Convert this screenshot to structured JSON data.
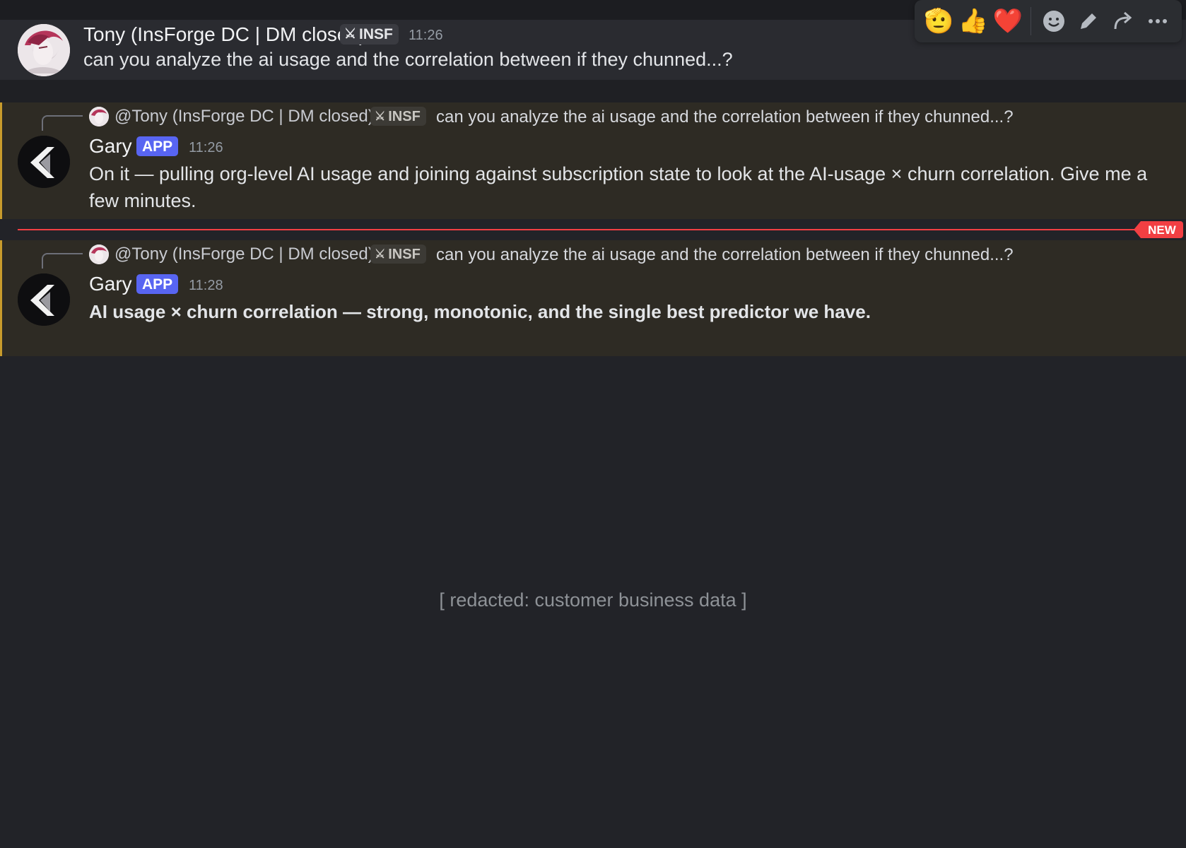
{
  "toolbar": {
    "reactions": [
      "🫡",
      "👍",
      "❤️"
    ],
    "actions": [
      {
        "name": "add-reaction-icon",
        "glyph": "☻"
      },
      {
        "name": "edit-icon",
        "glyph": "✎"
      },
      {
        "name": "forward-icon",
        "glyph": "↪"
      },
      {
        "name": "more-icon",
        "glyph": "···"
      }
    ]
  },
  "messages": [
    {
      "author": "Tony (InsForge DC | DM closed)",
      "tag": "INSF",
      "tag_icon": "sword-icon",
      "time": "11:26",
      "content": "can you analyze the ai usage and the correlation between if they chunned...?"
    },
    {
      "reply_to": {
        "author": "@Tony (InsForge DC | DM closed)",
        "tag": "INSF",
        "text": "can you analyze the ai usage and the correlation between if they chunned...?"
      },
      "author": "Gary",
      "badge": "APP",
      "time": "11:26",
      "content_line1": "On it — pulling org-level AI usage and joining against subscription state to look at the AI-usage × churn correlation. Give me a",
      "content_line2": "few minutes."
    },
    {
      "reply_to": {
        "author": "@Tony (InsForge DC | DM closed)",
        "tag": "INSF",
        "text": "can you analyze the ai usage and the correlation between if they chunned...?"
      },
      "author": "Gary",
      "badge": "APP",
      "time": "11:28",
      "content": "AI usage × churn correlation — strong, monotonic, and the single best predictor we have."
    }
  ],
  "new_divider": "NEW",
  "redacted": "[ redacted: customer business data ]",
  "colors": {
    "background": "#222328",
    "hover_row": "#2a2b30",
    "highlight_row": "#2e2b24",
    "accent": "#c89b2c",
    "app_badge": "#5865f2",
    "new_divider": "#f23f43"
  }
}
